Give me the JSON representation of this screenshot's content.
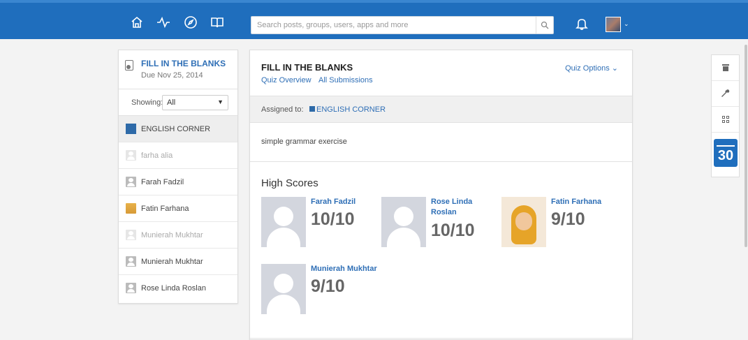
{
  "search": {
    "placeholder": "Search posts, groups, users, apps and more"
  },
  "sidebar": {
    "quiz_title": "FILL IN THE BLANKS",
    "due": "Due Nov 25, 2014",
    "showing_label": "Showing:",
    "showing_value": "All",
    "items": [
      {
        "label": "ENGLISH CORNER",
        "type": "group"
      },
      {
        "label": "farha alia",
        "type": "user"
      },
      {
        "label": "Farah Fadzil",
        "type": "user"
      },
      {
        "label": "Fatin Farhana",
        "type": "user"
      },
      {
        "label": "Munierah Mukhtar",
        "type": "user"
      },
      {
        "label": "Munierah Mukhtar",
        "type": "user"
      },
      {
        "label": "Rose Linda Roslan",
        "type": "user"
      }
    ]
  },
  "main": {
    "title": "FILL IN THE BLANKS",
    "links": [
      "Quiz Overview",
      "All Submissions"
    ],
    "options": "Quiz Options",
    "assigned_label": "Assigned to:",
    "assigned_group": "ENGLISH CORNER",
    "description": "simple grammar exercise",
    "high_scores_title": "High Scores",
    "scores": [
      {
        "name": "Farah Fadzil",
        "score": "10/10"
      },
      {
        "name": "Rose Linda Roslan",
        "score": "10/10"
      },
      {
        "name": "Fatin Farhana",
        "score": "9/10"
      },
      {
        "name": "Munierah Mukhtar",
        "score": "9/10"
      }
    ]
  },
  "right_sidebar": {
    "calendar_day": "30"
  },
  "icons": {
    "nav": [
      "home-icon",
      "activity-icon",
      "compass-icon",
      "book-icon"
    ],
    "right": [
      "store-icon",
      "wrench-icon",
      "grid-icon",
      "calendar-icon"
    ]
  },
  "colors": {
    "topbar": "#1f6ebd",
    "link": "#2f6fb6",
    "group": "#2e6aa8"
  }
}
